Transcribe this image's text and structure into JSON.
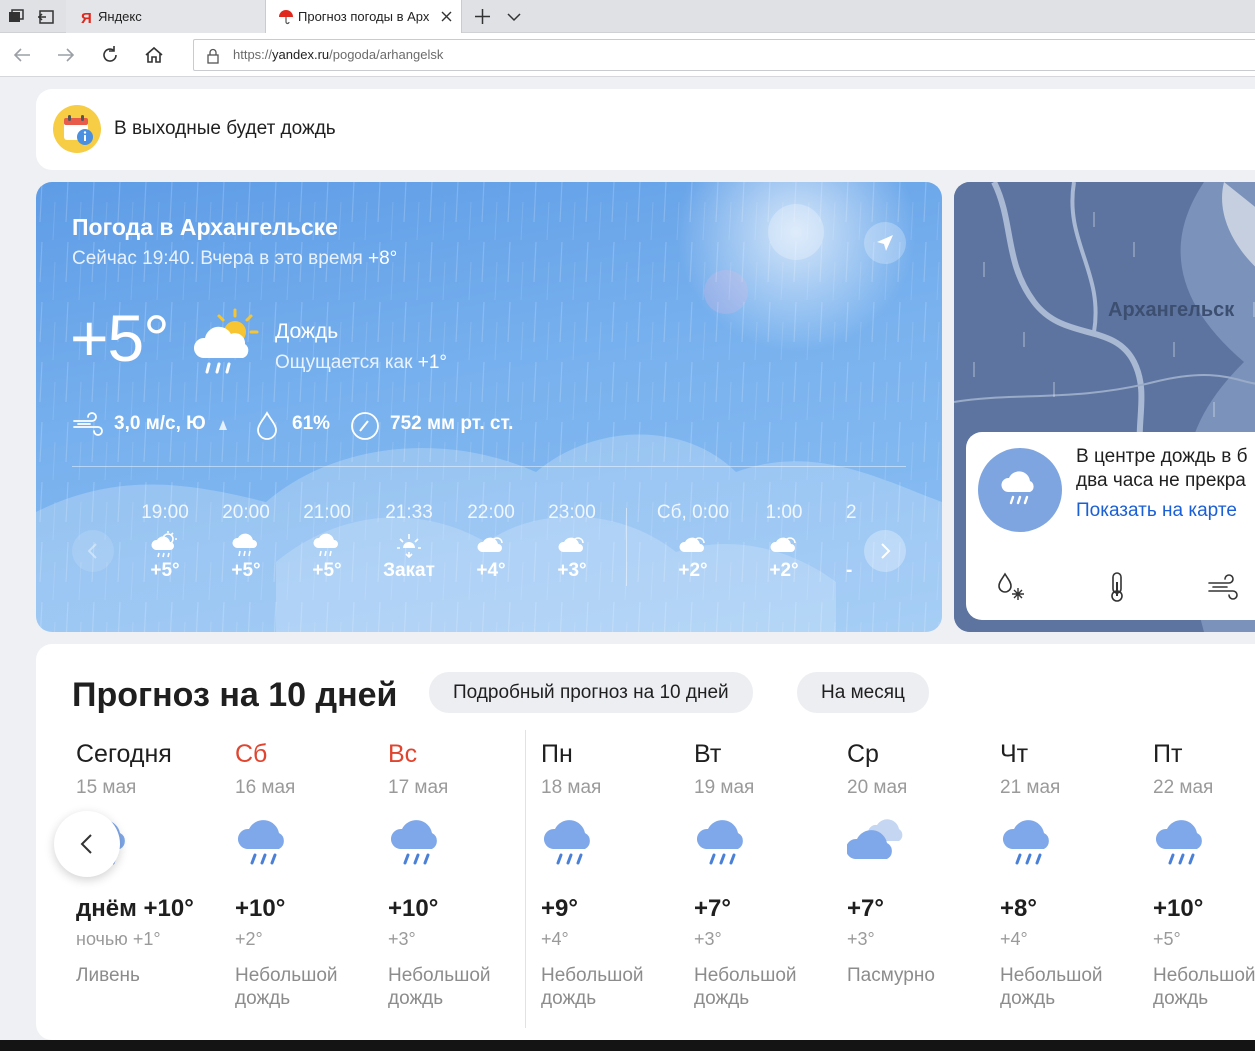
{
  "browser": {
    "tabs": [
      {
        "label": "Яндекс",
        "icon": "yandex-logo-icon",
        "active": false
      },
      {
        "label": "Прогноз погоды в Арх",
        "icon": "umbrella-icon",
        "active": true
      }
    ],
    "url_prefix": "https://",
    "url_domain": "yandex.ru",
    "url_path": "/pogoda/arhangelsk"
  },
  "alert": {
    "icon": "calendar-info-icon",
    "text": "В выходные будет дождь"
  },
  "current": {
    "title": "Погода в Архангельске",
    "subtitle_prefix": "Сейчас 19:40. Вчера в это время",
    "subtitle_temp": "+8°",
    "temp": "+5°",
    "icon": "partly-sunny-rain-icon",
    "condition": "Дождь",
    "feels_prefix": "Ощущается как",
    "feels_temp": "+1°",
    "wind": "3,0 м/с, Ю",
    "humidity": "61%",
    "pressure": "752 мм рт. ст."
  },
  "hourly": [
    {
      "time": "19:00",
      "icon": "sun-rain-icon",
      "value": "+5°"
    },
    {
      "time": "20:00",
      "icon": "rain-icon",
      "value": "+5°"
    },
    {
      "time": "21:00",
      "icon": "rain-icon",
      "value": "+5°"
    },
    {
      "time": "21:33",
      "icon": "sunset-icon",
      "value": "Закат"
    },
    {
      "time": "22:00",
      "icon": "cloud-icon",
      "value": "+4°"
    },
    {
      "time": "23:00",
      "icon": "cloud-icon",
      "value": "+3°"
    },
    {
      "time": "Сб, 0:00",
      "icon": "cloud-icon",
      "value": "+2°"
    },
    {
      "time": "1:00",
      "icon": "cloud-icon",
      "value": "+2°"
    },
    {
      "time": "2",
      "icon": "",
      "value": "-"
    }
  ],
  "map": {
    "city": "Архангельск",
    "message_line1": "В центре дождь в б",
    "message_line2": "два часа не прекра",
    "link": "Показать на карте",
    "layers": [
      "precipitation-icon",
      "thermometer-icon",
      "wind-icon"
    ]
  },
  "forecast": {
    "title": "Прогноз на 10 дней",
    "detailed_button": "Подробный прогноз на 10 дней",
    "month_button": "На месяц",
    "days": [
      {
        "name": "Сегодня",
        "date": "15 мая",
        "temp": "днём +10°",
        "night": "ночью +1°",
        "cond": "Ливень",
        "weekend": false,
        "icon": "rain-cloud-icon"
      },
      {
        "name": "Сб",
        "date": "16 мая",
        "temp": "+10°",
        "night": "+2°",
        "cond": "Небольшой дождь",
        "weekend": true,
        "icon": "rain-cloud-icon"
      },
      {
        "name": "Вс",
        "date": "17 мая",
        "temp": "+10°",
        "night": "+3°",
        "cond": "Небольшой дождь",
        "weekend": true,
        "icon": "rain-cloud-icon"
      },
      {
        "name": "Пн",
        "date": "18 мая",
        "temp": "+9°",
        "night": "+4°",
        "cond": "Небольшой дождь",
        "weekend": false,
        "icon": "rain-cloud-icon"
      },
      {
        "name": "Вт",
        "date": "19 мая",
        "temp": "+7°",
        "night": "+3°",
        "cond": "Небольшой дождь",
        "weekend": false,
        "icon": "rain-cloud-icon"
      },
      {
        "name": "Ср",
        "date": "20 мая",
        "temp": "+7°",
        "night": "+3°",
        "cond": "Пасмурно",
        "weekend": false,
        "icon": "overcast-icon"
      },
      {
        "name": "Чт",
        "date": "21 мая",
        "temp": "+8°",
        "night": "+4°",
        "cond": "Небольшой дождь",
        "weekend": false,
        "icon": "rain-cloud-icon"
      },
      {
        "name": "Пт",
        "date": "22 мая",
        "temp": "+10°",
        "night": "+5°",
        "cond": "Небольшой дождь",
        "weekend": false,
        "icon": "rain-cloud-icon"
      }
    ]
  },
  "colors": {
    "accent": "#1a5fd6",
    "weekend": "#e0452f",
    "card_blue": "#6fa9ec"
  }
}
